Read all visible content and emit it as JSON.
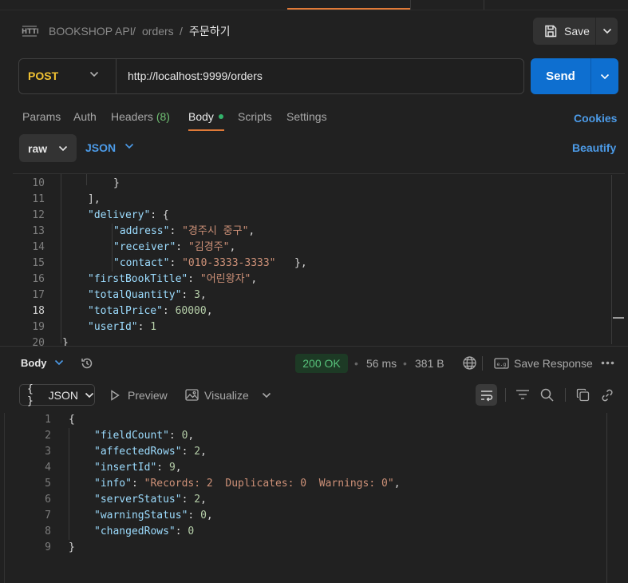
{
  "breadcrumb": {
    "collection": "BOOKSHOP API",
    "folder": "orders",
    "request": "주문하기",
    "separator": "/"
  },
  "save": {
    "label": "Save"
  },
  "request": {
    "method": "POST",
    "url": "http://localhost:9999/orders"
  },
  "send": {
    "label": "Send"
  },
  "tabs": {
    "params": "Params",
    "auth": "Auth",
    "headers": "Headers",
    "headers_count": "(8)",
    "body": "Body",
    "scripts": "Scripts",
    "settings": "Settings"
  },
  "links": {
    "cookies": "Cookies",
    "beautify": "Beautify"
  },
  "body_options": {
    "mode": "raw",
    "language": "JSON"
  },
  "request_body": [
    {
      "n": "10",
      "indent": 2,
      "text": "}"
    },
    {
      "n": "11",
      "indent": 1,
      "text": "],"
    },
    {
      "n": "12",
      "indent": 1,
      "key": "\"delivery\"",
      "rest": ": {"
    },
    {
      "n": "13",
      "indent": 2,
      "key": "\"address\"",
      "sep": ": ",
      "str": "\"경주시 중구\"",
      "tail": ","
    },
    {
      "n": "14",
      "indent": 2,
      "key": "\"receiver\"",
      "sep": ": ",
      "str": "\"김경주\"",
      "tail": ","
    },
    {
      "n": "15",
      "indent": 2,
      "key": "\"contact\"",
      "sep": ": ",
      "str": "\"010-3333-3333\"",
      "tail": "   },"
    },
    {
      "n": "16",
      "indent": 1,
      "key": "\"firstBookTitle\"",
      "sep": ": ",
      "str": "\"어린왕자\"",
      "tail": ","
    },
    {
      "n": "17",
      "indent": 1,
      "key": "\"totalQuantity\"",
      "sep": ": ",
      "num": "3",
      "tail": ","
    },
    {
      "n": "18",
      "indent": 1,
      "key": "\"totalPrice\"",
      "sep": ": ",
      "num": "60000",
      "tail": ","
    },
    {
      "n": "19",
      "indent": 1,
      "key": "\"userId\"",
      "sep": ": ",
      "num": "1",
      "tail": ""
    },
    {
      "n": "20",
      "indent": 0,
      "text": "}"
    }
  ],
  "response": {
    "body_label": "Body",
    "status": "200 OK",
    "time": "56 ms",
    "size": "381 B",
    "save_response": "Save Response",
    "format": "JSON",
    "preview": "Preview",
    "visualize": "Visualize",
    "lines": [
      {
        "n": "1",
        "indent": 0,
        "text": "{"
      },
      {
        "n": "2",
        "indent": 1,
        "key": "\"fieldCount\"",
        "sep": ": ",
        "num": "0",
        "tail": ","
      },
      {
        "n": "3",
        "indent": 1,
        "key": "\"affectedRows\"",
        "sep": ": ",
        "num": "2",
        "tail": ","
      },
      {
        "n": "4",
        "indent": 1,
        "key": "\"insertId\"",
        "sep": ": ",
        "num": "9",
        "tail": ","
      },
      {
        "n": "5",
        "indent": 1,
        "key": "\"info\"",
        "sep": ": ",
        "str": "\"Records: 2  Duplicates: 0  Warnings: 0\"",
        "tail": ","
      },
      {
        "n": "6",
        "indent": 1,
        "key": "\"serverStatus\"",
        "sep": ": ",
        "num": "2",
        "tail": ","
      },
      {
        "n": "7",
        "indent": 1,
        "key": "\"warningStatus\"",
        "sep": ": ",
        "num": "0",
        "tail": ","
      },
      {
        "n": "8",
        "indent": 1,
        "key": "\"changedRows\"",
        "sep": ": ",
        "num": "0",
        "tail": ""
      },
      {
        "n": "9",
        "indent": 0,
        "text": "}"
      }
    ]
  },
  "colors": {
    "accent_orange": "#e07a38",
    "send_blue": "#0e6fd0",
    "link_blue": "#4c9be8",
    "method_yellow": "#f1c232",
    "status_green": "#57c27b"
  },
  "icons": {
    "http": "http-icon",
    "save": "floppy-disk-icon",
    "history": "history-icon",
    "globe": "globe-icon",
    "save_response": "save-response-icon",
    "more": "more-horizontal-icon",
    "preview": "play-icon",
    "visualize": "image-icon",
    "wrap": "wrap-lines-icon",
    "filter": "filter-icon",
    "search": "search-icon",
    "copy": "copy-icon",
    "link": "link-icon"
  }
}
